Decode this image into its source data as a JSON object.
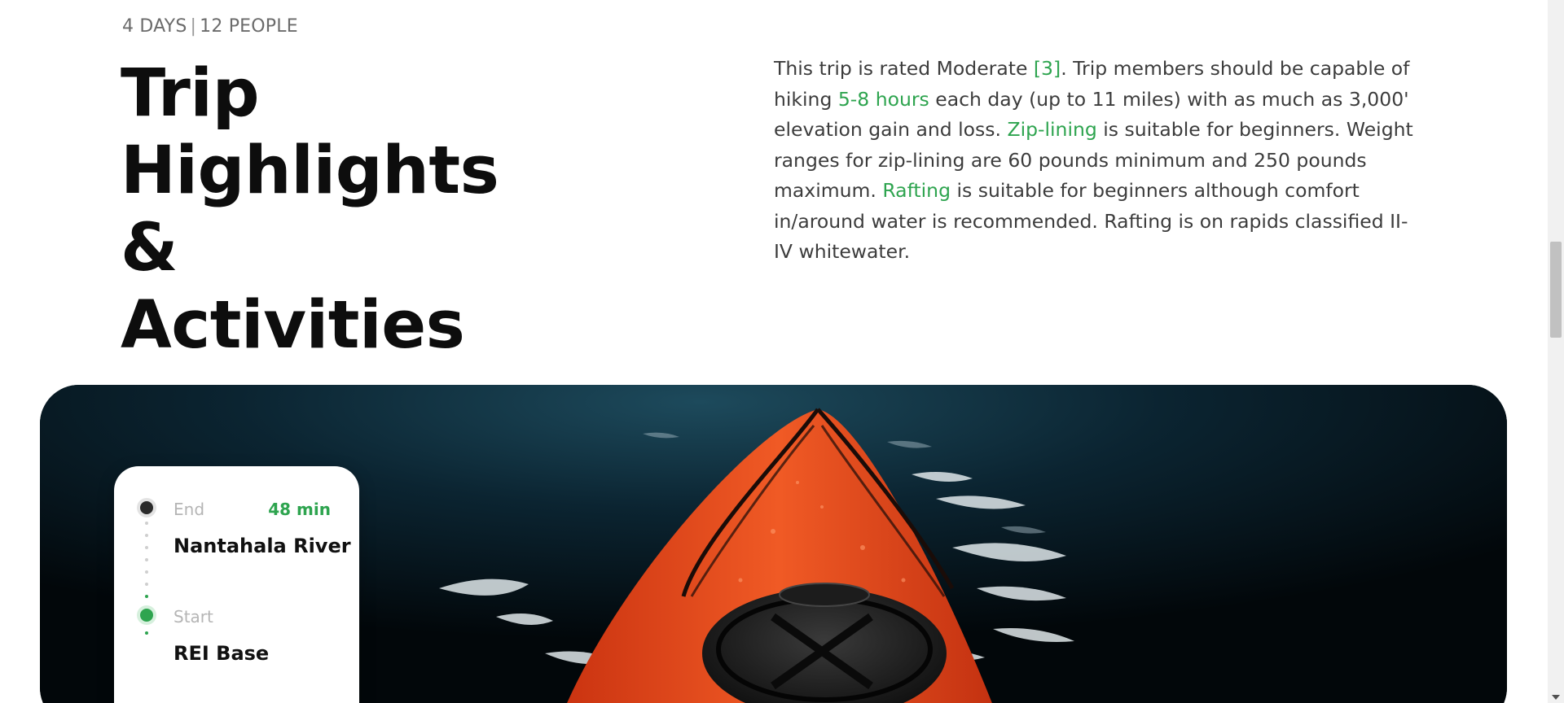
{
  "trip": {
    "days": "4 DAYS",
    "separator": "|",
    "people": "12 PEOPLE"
  },
  "heading": {
    "line1": "Trip",
    "line2": "Highlights &",
    "line3": "Activities"
  },
  "description": {
    "p1": "This trip is rated Moderate ",
    "rating": "[3]",
    "p2": ". Trip members should be capable of hiking ",
    "hours": "5-8 hours",
    "p3": " each day (up to 11 miles) with as much as 3,000' elevation gain and loss. ",
    "ziplining": "Zip-lining",
    "p4": " is suitable for beginners. Weight ranges for zip-lining are 60 pounds minimum and 250 pounds maximum. ",
    "rafting": "Rafting",
    "p5": " is suitable for beginners although comfort in/around water is recommended. Rafting is on rapids classified II-IV whitewater."
  },
  "route": {
    "end_label": "End",
    "end_place": "Nantahala River",
    "duration": "48 min",
    "start_label": "Start",
    "start_place": "REI Base"
  },
  "colors": {
    "accent": "#2ea44f",
    "heading": "#0d0d0d",
    "body_text": "#3c3c3c",
    "kayak": "#e8451c",
    "water": "#02070a"
  },
  "icons": {
    "end_marker": "filled-dark-circle",
    "start_marker": "filled-green-circle"
  }
}
